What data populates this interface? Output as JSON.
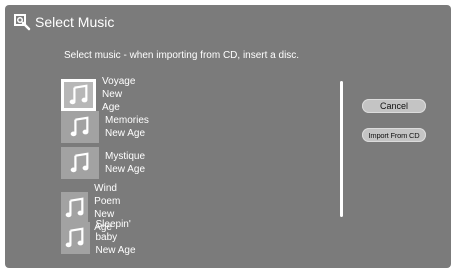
{
  "header": {
    "title": "Select Music",
    "icon": "music-search-icon"
  },
  "instruction": "Select music - when importing from CD, insert a disc.",
  "tracks": [
    {
      "title": "Voyage",
      "genre": "New Age",
      "selected": true
    },
    {
      "title": "Memories",
      "genre": "New Age",
      "selected": false
    },
    {
      "title": "Mystique",
      "genre": "New Age",
      "selected": false
    },
    {
      "title": "Wind Poem",
      "genre": "New Age",
      "selected": false
    },
    {
      "title": "Sleepin' baby",
      "genre": "New Age",
      "selected": false
    }
  ],
  "buttons": {
    "cancel": "Cancel",
    "import": "Import From CD"
  },
  "colors": {
    "background": "#7b7b7b",
    "thumbnail": "#a2a2a2",
    "button": "#c4c4c4",
    "text": "#ffffff"
  }
}
